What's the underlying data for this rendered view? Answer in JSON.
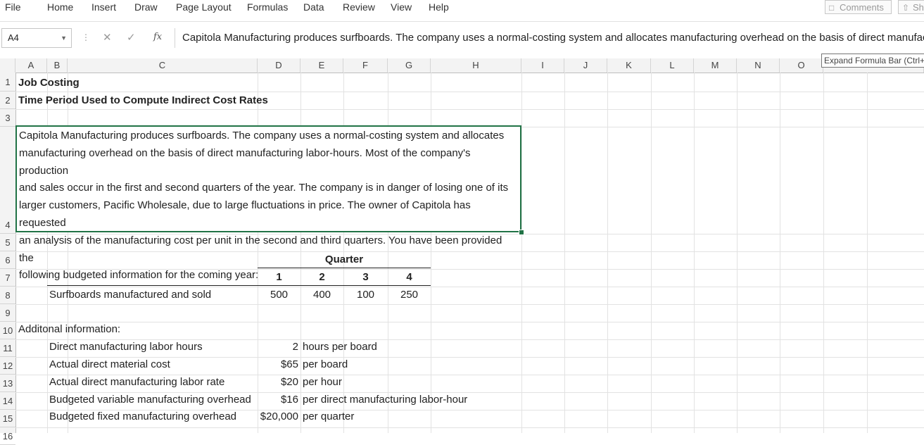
{
  "menu": {
    "items": [
      "File",
      "Home",
      "Insert",
      "Draw",
      "Page Layout",
      "Formulas",
      "Data",
      "Review",
      "View",
      "Help"
    ],
    "comments_label": "Comments",
    "share_label": "Sh"
  },
  "formula_bar": {
    "name_box": "A4",
    "fx": "fx",
    "content": "Capitola Manufacturing produces surfboards. The company uses a normal-costing system and allocates manufacturing overhead on the basis of direct manufacturing labor-",
    "tooltip": "Expand Formula Bar (Ctrl+S"
  },
  "grid": {
    "columns": [
      "A",
      "B",
      "C",
      "D",
      "E",
      "F",
      "G",
      "H",
      "I",
      "J",
      "K",
      "L",
      "M",
      "N",
      "O"
    ],
    "rows": [
      "1",
      "2",
      "3",
      "4",
      "5",
      "6",
      "7",
      "8",
      "9",
      "10",
      "11",
      "12",
      "13",
      "14",
      "15",
      "16"
    ]
  },
  "sheet": {
    "title": "Job Costing",
    "subtitle": "Time Period Used to Compute Indirect Cost Rates",
    "description": "Capitola Manufacturing produces surfboards. The company uses a normal-costing system and allocates manufacturing overhead on the basis of direct manufacturing labor-hours. Most of the company's production and sales occur in the first and second quarters of the year. The company is in danger of losing one of its larger customers, Pacific Wholesale, due to large fluctuations in price. The owner of Capitola has requested an analysis of the manufacturing cost per unit in the second and third quarters. You have been provided the following budgeted information for the coming year:",
    "description_lines": [
      "Capitola Manufacturing produces surfboards. The company uses a normal-costing system and allocates",
      "manufacturing overhead on the basis of direct manufacturing labor-hours. Most of the company's production",
      "and sales occur in the first and second quarters of the year. The company is in danger of losing one of its",
      "larger customers, Pacific Wholesale, due to large fluctuations in price. The owner of Capitola has requested",
      "an analysis of the manufacturing cost per unit in the second and third quarters. You have been provided the",
      "following budgeted information for the coming year:"
    ],
    "quarter_header": "Quarter",
    "quarters": [
      "1",
      "2",
      "3",
      "4"
    ],
    "surfboards_label": "Surfboards manufactured and sold",
    "surfboards_values": [
      "500",
      "400",
      "100",
      "250"
    ],
    "additional_label": "Additonal information:",
    "info_rows": [
      {
        "label": "Direct manufacturing labor hours",
        "value": "2",
        "unit": "hours per board"
      },
      {
        "label": "Actual direct material cost",
        "value": "$65",
        "unit": "per board"
      },
      {
        "label": "Actual direct manufacturing labor rate",
        "value": "$20",
        "unit": "per hour"
      },
      {
        "label": "Budgeted variable manufacturing overhead",
        "value": "$16",
        "unit": "per direct manufacturing labor-hour"
      },
      {
        "label": "Budgeted fixed manufacturing overhead",
        "value": "$20,000",
        "unit": "per quarter"
      }
    ]
  },
  "colors": {
    "selection": "#217346",
    "header_bg": "#f3f3f3",
    "grid": "#e2e2e2"
  }
}
